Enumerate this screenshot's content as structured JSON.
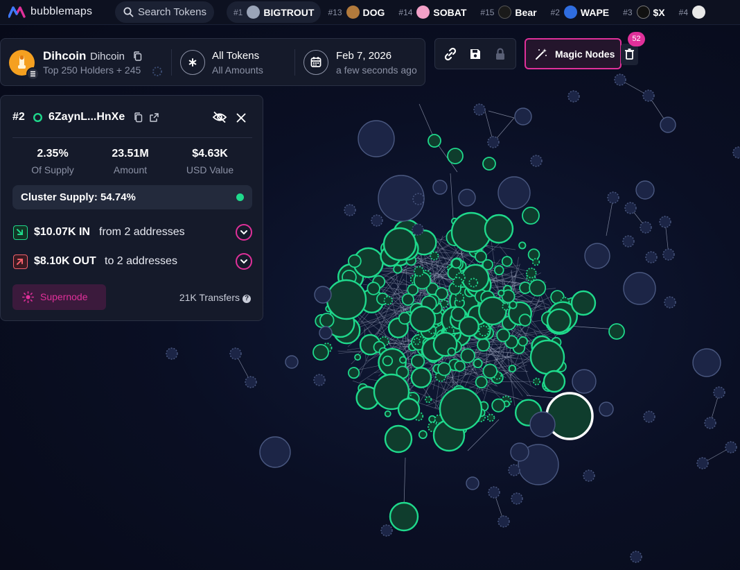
{
  "brand": {
    "name": "bubblemaps"
  },
  "search": {
    "label": "Search Tokens"
  },
  "token_tabs": [
    {
      "rank": "#1",
      "symbol": "BIGTROUT",
      "avatar_color": "#9aa4b8"
    },
    {
      "rank": "#13",
      "symbol": "DOG",
      "avatar_color": "#b27a3c"
    },
    {
      "rank": "#14",
      "symbol": "SOBAT",
      "avatar_color": "#f2a0c8"
    },
    {
      "rank": "#15",
      "symbol": "Bear",
      "avatar_color": "#1a1a1a"
    },
    {
      "rank": "#2",
      "symbol": "WAPE",
      "avatar_color": "#2f6de0"
    },
    {
      "rank": "#3",
      "symbol": "$X",
      "avatar_color": "#111111"
    },
    {
      "rank": "#4",
      "symbol": "",
      "avatar_color": "#e8e8e8"
    }
  ],
  "token": {
    "name": "Dihcoin",
    "ticker": "Dihcoin",
    "holders": "Top 250 Holders + 245",
    "filter_title": "All Tokens",
    "filter_sub": "All Amounts",
    "date": "Feb 7, 2026",
    "date_sub": "a few seconds ago"
  },
  "tools": {
    "magic_label": "Magic Nodes",
    "badge": "52"
  },
  "wallet": {
    "rank": "#2",
    "address": "6ZaynL...HnXe",
    "stats": [
      {
        "value": "2.35%",
        "label": "Of Supply"
      },
      {
        "value": "23.51M",
        "label": "Amount"
      },
      {
        "value": "$4.63K",
        "label": "USD Value"
      }
    ],
    "cluster": "Cluster Supply: 54.74%",
    "in_amount": "$10.07K IN",
    "in_desc": "from 2 addresses",
    "out_amount": "$8.10K OUT",
    "out_desc": "to 2 addresses",
    "supernode": "Supernode",
    "transfers": "21K Transfers"
  },
  "colors": {
    "accent": "#e0309a",
    "green": "#1fd98c",
    "node_blue": "#1c2546",
    "background": "#0a0f24"
  }
}
